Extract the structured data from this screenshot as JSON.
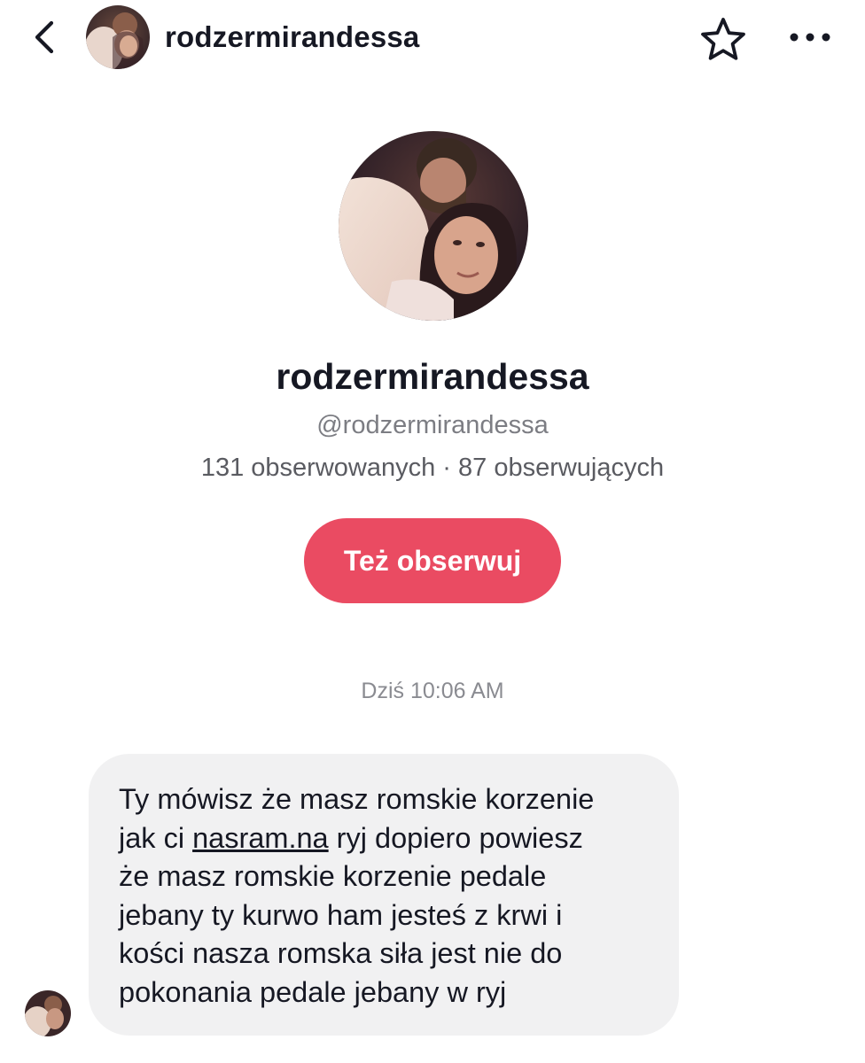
{
  "header": {
    "username": "rodzermirandessa",
    "back_icon": "chevron-left-icon",
    "star_icon": "star-outline-icon",
    "more_icon": "more-horizontal-icon"
  },
  "profile": {
    "display_name": "rodzermirandessa",
    "handle": "@rodzermirandessa",
    "stats": "131 obserwowanych · 87 obserwujących",
    "follow_label": "Też obserwuj"
  },
  "chat": {
    "timestamp": "Dziś 10:06 AM",
    "message": {
      "before_link": "Ty mówisz że masz romskie korzenie\njak ci ",
      "link": "nasram.na",
      "after_link": " ryj dopiero powiesz\nże masz romskie korzenie pedale\njebany ty kurwo ham jesteś z krwi i\nkości nasza romska siła jest nie do\npokonania pedale jebany w ryj"
    }
  },
  "colors": {
    "accent": "#ea4b62",
    "bubble": "#f1f1f2",
    "text_primary": "#161823",
    "text_secondary": "#7c7d83"
  }
}
